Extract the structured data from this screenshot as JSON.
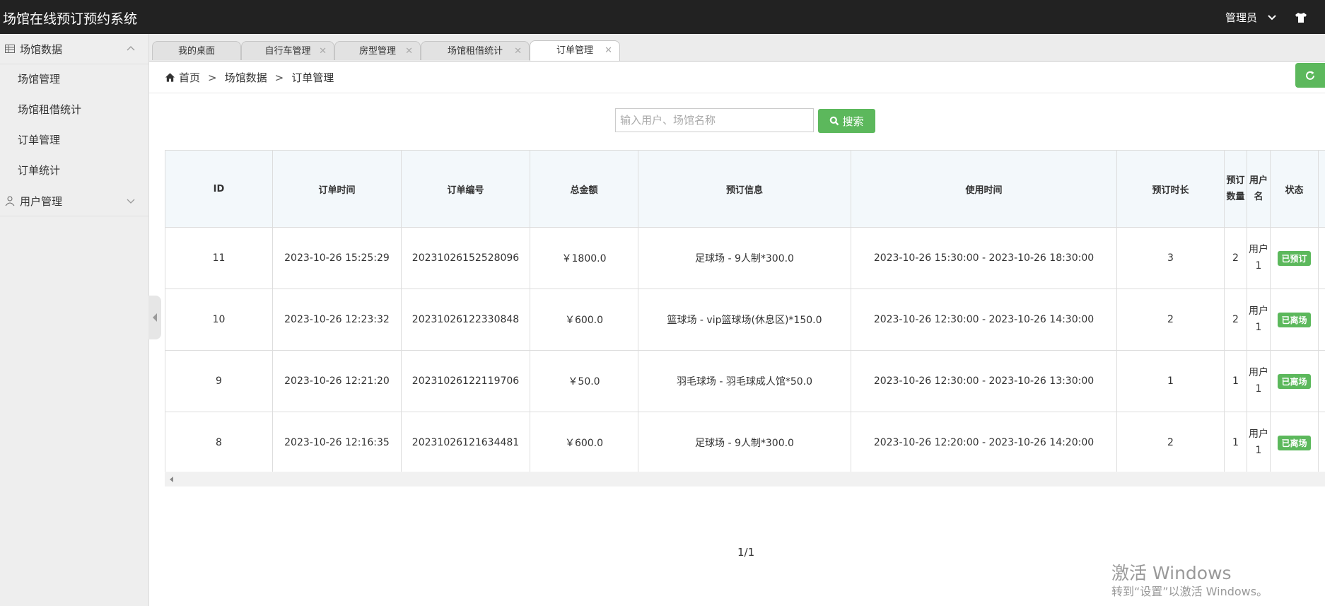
{
  "header": {
    "title": "场馆在线预订预约系统",
    "user": "管理员"
  },
  "sidebar": {
    "groups": [
      {
        "label": "场馆数据",
        "items": [
          "场馆管理",
          "场馆租借统计",
          "订单管理",
          "订单统计"
        ]
      },
      {
        "label": "用户管理"
      }
    ]
  },
  "tabs": [
    "我的桌面",
    "自行车管理",
    "房型管理",
    "场馆租借统计",
    "订单管理"
  ],
  "breadcrumb": [
    "首页",
    "场馆数据",
    "订单管理"
  ],
  "search": {
    "placeholder": "输入用户、场馆名称",
    "button": "搜索"
  },
  "table": {
    "headers": [
      "ID",
      "订单时间",
      "订单编号",
      "总金额",
      "预订信息",
      "使用时间",
      "预订时长",
      "预订数量",
      "用户名",
      "状态"
    ],
    "rows": [
      [
        "11",
        "2023-10-26 15:25:29",
        "20231026152528096",
        "￥1800.0",
        "足球场 - 9人制*300.0",
        "2023-10-26 15:30:00 - 2023-10-26 18:30:00",
        "3",
        "2",
        "用户1",
        "已预订"
      ],
      [
        "10",
        "2023-10-26 12:23:32",
        "20231026122330848",
        "￥600.0",
        "篮球场 - vip篮球场(休息区)*150.0",
        "2023-10-26 12:30:00 - 2023-10-26 14:30:00",
        "2",
        "2",
        "用户1",
        "已离场"
      ],
      [
        "9",
        "2023-10-26 12:21:20",
        "20231026122119706",
        "￥50.0",
        "羽毛球场 - 羽毛球成人馆*50.0",
        "2023-10-26 12:30:00 - 2023-10-26 13:30:00",
        "1",
        "1",
        "用户1",
        "已离场"
      ],
      [
        "8",
        "2023-10-26 12:16:35",
        "20231026121634481",
        "￥600.0",
        "足球场 - 9人制*300.0",
        "2023-10-26 12:20:00 - 2023-10-26 14:20:00",
        "2",
        "1",
        "用户1",
        "已离场"
      ]
    ]
  },
  "pagination": "1/1",
  "watermark": {
    "line1": "激活 Windows",
    "line2": "转到“设置”以激活 Windows。"
  },
  "colors": {
    "header_bg": "#222222",
    "accent_green": "#5cb85c",
    "sidebar_bg": "#eeeeee"
  }
}
